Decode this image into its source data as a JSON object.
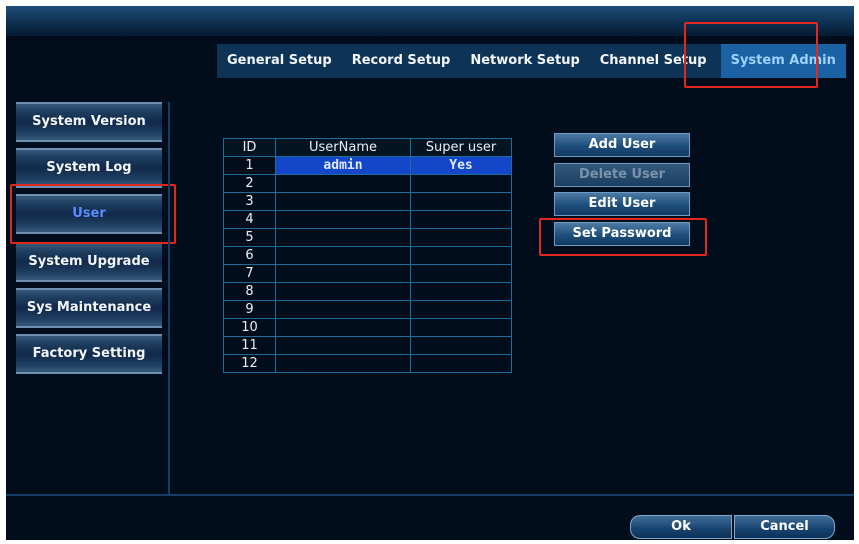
{
  "tabs": [
    "General Setup",
    "Record Setup",
    "Network Setup",
    "Channel Setup",
    "System Admin"
  ],
  "sidebar": [
    "System Version",
    "System Log",
    "User",
    "System Upgrade",
    "Sys Maintenance",
    "Factory Setting"
  ],
  "table": {
    "headers": [
      "ID",
      "UserName",
      "Super user"
    ],
    "rows": [
      [
        "1",
        "admin",
        "Yes"
      ],
      [
        "2",
        "",
        ""
      ],
      [
        "3",
        "",
        ""
      ],
      [
        "4",
        "",
        ""
      ],
      [
        "5",
        "",
        ""
      ],
      [
        "6",
        "",
        ""
      ],
      [
        "7",
        "",
        ""
      ],
      [
        "8",
        "",
        ""
      ],
      [
        "9",
        "",
        ""
      ],
      [
        "10",
        "",
        ""
      ],
      [
        "11",
        "",
        ""
      ],
      [
        "12",
        "",
        ""
      ]
    ]
  },
  "actions": [
    "Add User",
    "Delete User",
    "Edit User",
    "Set Password"
  ],
  "footer": {
    "ok": "Ok",
    "cancel": "Cancel"
  },
  "colors": {
    "highlight": "#e0281e",
    "selected_row": "#1346c8",
    "active_tab": "#1b62a4"
  }
}
